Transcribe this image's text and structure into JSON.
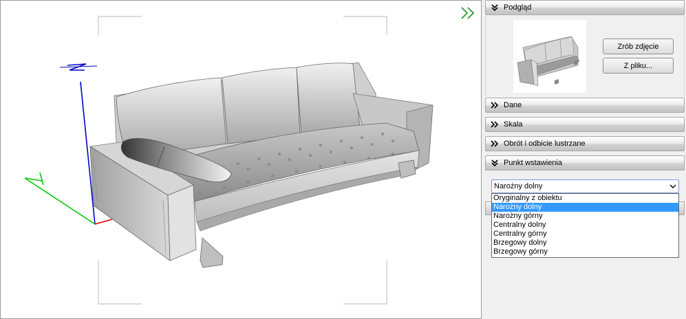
{
  "panel": {
    "preview": {
      "title": "Podgląd",
      "take_photo_label": "Zrób zdjęcie",
      "from_file_label": "Z pliku..."
    },
    "sections": [
      {
        "title": "Dane",
        "expanded": false
      },
      {
        "title": "Skala",
        "expanded": false
      },
      {
        "title": "Obrót i odbicie lustrzane",
        "expanded": false
      },
      {
        "title": "Punkt wstawienia",
        "expanded": true
      }
    ],
    "insertion_point": {
      "selected": "Narożny dolny",
      "options": [
        "Oryginalny z obiektu",
        "Narożny dolny",
        "Narożny górny",
        "Centralny dolny",
        "Centralny górny",
        "Brzegowy dolny",
        "Brzegowy górny"
      ],
      "highlighted_index": 1
    }
  },
  "viewport": {
    "axes": {
      "z_color": "#0000c8",
      "y_color": "#00c800",
      "x_color": "#e00000"
    },
    "toggle_color": "#3fa33f"
  }
}
